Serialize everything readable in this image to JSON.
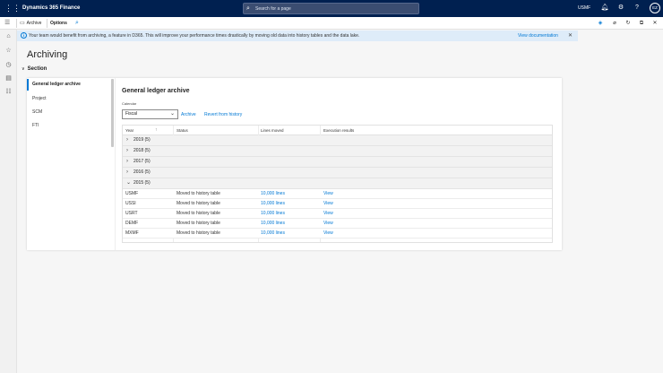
{
  "topbar": {
    "app_name": "Dynamics 365 Finance",
    "search_placeholder": "Search for a page",
    "company": "USMF",
    "avatar_initials": "EZ"
  },
  "actionbar": {
    "archive_label": "Archive",
    "options_label": "Options"
  },
  "infobar": {
    "message": "Your team would benefit from archiving, a feature in D365. This will improve your performance times drastically by moving old data into history tables and the data lake.",
    "link": "View documentation"
  },
  "page": {
    "title": "Archiving",
    "section_label": "Section"
  },
  "nav_items": [
    {
      "label": "General ledger archive",
      "active": true
    },
    {
      "label": "Project",
      "active": false
    },
    {
      "label": "SCM",
      "active": false
    },
    {
      "label": "FTI",
      "active": false
    }
  ],
  "content": {
    "title": "General ledger archive",
    "calendar_label": "Calendar",
    "calendar_value": "Fiscal",
    "archive_link": "Archive",
    "revert_link": "Revert from history"
  },
  "grid": {
    "columns": [
      "Year",
      "Status",
      "Lines moved",
      "Execution results"
    ],
    "groups": [
      {
        "label": "2019 (5)",
        "expanded": false
      },
      {
        "label": "2018 (5)",
        "expanded": false
      },
      {
        "label": "2017 (5)",
        "expanded": false
      },
      {
        "label": "2016 (5)",
        "expanded": false
      },
      {
        "label": "2015 (5)",
        "expanded": true
      }
    ],
    "rows": [
      {
        "company": "USMF",
        "status": "Moved to history table",
        "lines": "10,000 lines",
        "result": "View"
      },
      {
        "company": "USSI",
        "status": "Moved to history table",
        "lines": "10,000 lines",
        "result": "View"
      },
      {
        "company": "USRT",
        "status": "Moved to history table",
        "lines": "10,000 lines",
        "result": "View"
      },
      {
        "company": "DEMF",
        "status": "Moved to history table",
        "lines": "10,000 lines",
        "result": "View"
      },
      {
        "company": "MXMF",
        "status": "Moved to history table",
        "lines": "10,000 lines",
        "result": "View"
      }
    ]
  }
}
